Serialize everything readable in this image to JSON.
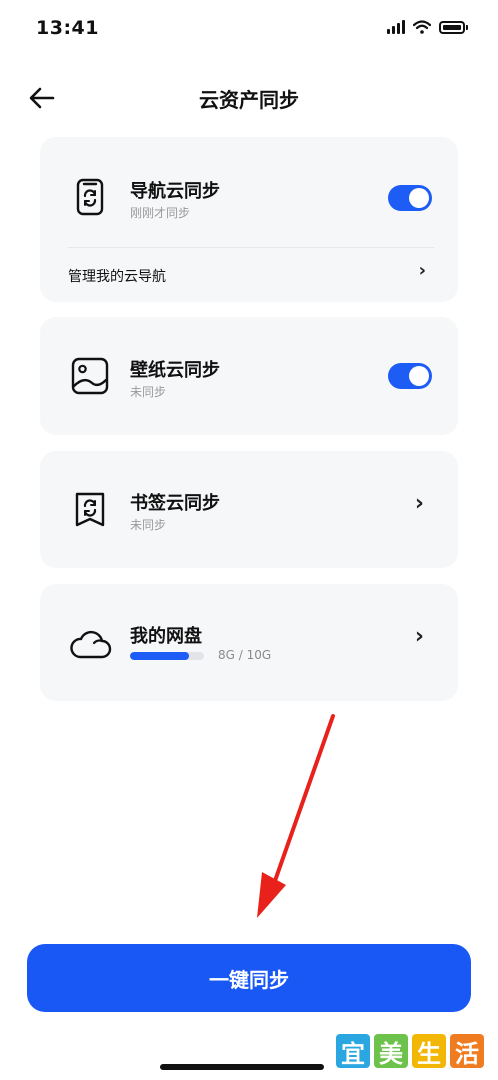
{
  "status_bar": {
    "time": "13:41"
  },
  "header": {
    "title": "云资产同步"
  },
  "cards": {
    "nav_sync": {
      "title": "导航云同步",
      "subtitle": "刚刚才同步",
      "toggle_on": true,
      "manage_link": "管理我的云导航",
      "manage_chevron": "›"
    },
    "wallpaper_sync": {
      "title": "壁纸云同步",
      "subtitle": "未同步",
      "toggle_on": true
    },
    "bookmark_sync": {
      "title": "书签云同步",
      "subtitle": "未同步",
      "chevron": "›"
    },
    "my_drive": {
      "title": "我的网盘",
      "usage_text": "8G / 10G",
      "usage_fraction": 0.8,
      "chevron": "›"
    }
  },
  "primary_action": {
    "label": "一键同步"
  },
  "watermark": {
    "chars": [
      "宜",
      "美",
      "生",
      "活"
    ],
    "colors": [
      "#2aa7e0",
      "#6cc24a",
      "#f2b705",
      "#f07c22"
    ]
  },
  "colors": {
    "accent": "#1a58f5",
    "annotation_arrow": "#e8221b"
  }
}
